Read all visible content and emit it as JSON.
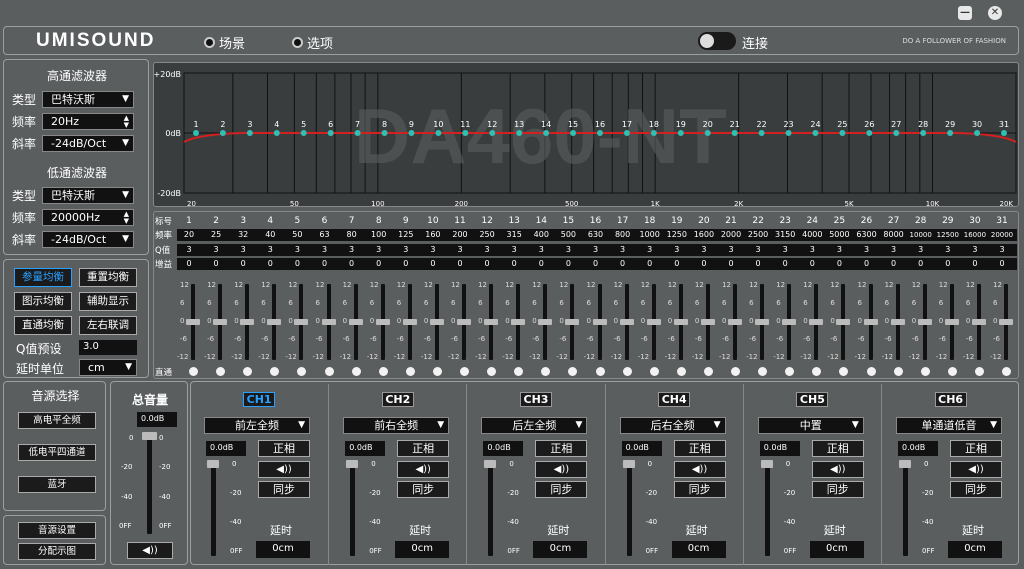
{
  "window": {
    "minimize": "—",
    "close": "✕"
  },
  "header": {
    "logo": "UMISOUND",
    "tabs": [
      "场景",
      "选项"
    ],
    "connect_label": "连接",
    "slogan": "DO A FOLLOWER OF FASHION"
  },
  "highpass": {
    "title": "高通滤波器",
    "type_label": "类型",
    "type_value": "巴特沃斯",
    "freq_label": "频率",
    "freq_value": "20Hz",
    "slope_label": "斜率",
    "slope_value": "-24dB/Oct"
  },
  "lowpass": {
    "title": "低通滤波器",
    "type_label": "类型",
    "type_value": "巴特沃斯",
    "freq_label": "频率",
    "freq_value": "20000Hz",
    "slope_label": "斜率",
    "slope_value": "-24dB/Oct"
  },
  "eq_buttons": [
    "参量均衡",
    "重置均衡",
    "图示均衡",
    "辅助显示",
    "直通均衡",
    "左右联调"
  ],
  "q_preset": {
    "label": "Q值预设",
    "value": "3.0"
  },
  "delay_unit": {
    "label": "延时单位",
    "value": "cm"
  },
  "graph": {
    "watermark": "DA460-NT",
    "y_top": "+20dB",
    "y_mid": "0dB",
    "y_bot": "-20dB",
    "x_labels": [
      "20",
      "50",
      "100",
      "200",
      "500",
      "1K",
      "2K",
      "5K",
      "10K",
      "20K"
    ]
  },
  "eq_table": {
    "labels": [
      "标号",
      "频率",
      "Q值",
      "增益",
      "直通"
    ],
    "numbers": [
      "1",
      "2",
      "3",
      "4",
      "5",
      "6",
      "7",
      "8",
      "9",
      "10",
      "11",
      "12",
      "13",
      "14",
      "15",
      "16",
      "17",
      "18",
      "19",
      "20",
      "21",
      "22",
      "23",
      "24",
      "25",
      "26",
      "27",
      "28",
      "29",
      "30",
      "31"
    ],
    "freqs": [
      "20",
      "25",
      "32",
      "40",
      "50",
      "63",
      "80",
      "100",
      "125",
      "160",
      "200",
      "250",
      "315",
      "400",
      "500",
      "630",
      "800",
      "1000",
      "1250",
      "1600",
      "2000",
      "2500",
      "3150",
      "4000",
      "5000",
      "6300",
      "8000",
      "10000",
      "12500",
      "16000",
      "20000"
    ],
    "q": "3",
    "gain": "0",
    "scale": [
      "12",
      "6",
      "0",
      "-6",
      "-12"
    ]
  },
  "source": {
    "title": "音源选择",
    "items": [
      "高电平全频",
      "低电平四通道",
      "蓝牙"
    ],
    "settings": "音源设置",
    "routing": "分配示图"
  },
  "master": {
    "title": "总音量",
    "value": "0.0dB",
    "scale": [
      "0",
      "-20",
      "-40",
      "0FF"
    ]
  },
  "channels": [
    {
      "id": "CH1",
      "assign": "前左全频"
    },
    {
      "id": "CH2",
      "assign": "前右全频"
    },
    {
      "id": "CH3",
      "assign": "后左全频"
    },
    {
      "id": "CH4",
      "assign": "后右全频"
    },
    {
      "id": "CH5",
      "assign": "中置"
    },
    {
      "id": "CH6",
      "assign": "单通道低音"
    }
  ],
  "channel_common": {
    "db": "0.0dB",
    "phase": "正相",
    "sync": "同步",
    "delay_label": "延时",
    "delay_value": "0cm",
    "scale": [
      "0",
      "-20",
      "-40",
      "0FF"
    ]
  }
}
